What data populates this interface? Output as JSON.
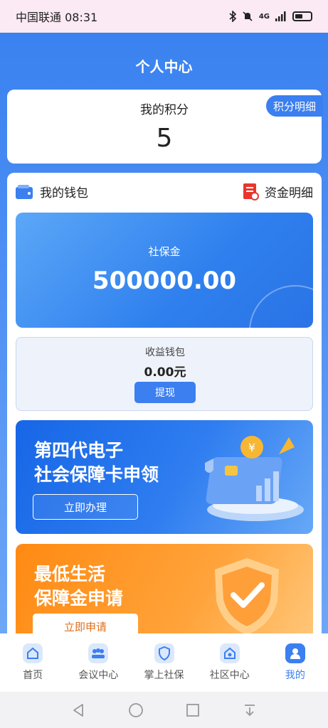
{
  "status": {
    "carrier_time": "中国联通 08:31",
    "network": "4G"
  },
  "header": {
    "title": "个人中心"
  },
  "points": {
    "label": "我的积分",
    "value": "5",
    "detail_button": "积分明细"
  },
  "wallet": {
    "title": "我的钱包",
    "fund_detail": "资金明细",
    "social_security": {
      "label": "社保金",
      "amount": "500000.00"
    },
    "income": {
      "label": "收益钱包",
      "amount": "0.00元",
      "withdraw_button": "提现"
    }
  },
  "banners": [
    {
      "title_line1": "第四代电子",
      "title_line2": "社会保障卡申领",
      "button": "立即办理"
    },
    {
      "title_line1": "最低生活",
      "title_line2": "保障金申请",
      "button": "立即申请"
    }
  ],
  "tabs": [
    {
      "label": "首页",
      "icon": "home-icon"
    },
    {
      "label": "会议中心",
      "icon": "meeting-icon"
    },
    {
      "label": "掌上社保",
      "icon": "shield-icon"
    },
    {
      "label": "社区中心",
      "icon": "community-icon"
    },
    {
      "label": "我的",
      "icon": "user-icon"
    }
  ],
  "colors": {
    "primary": "#3b7ff0",
    "orange": "#ff8a12"
  }
}
